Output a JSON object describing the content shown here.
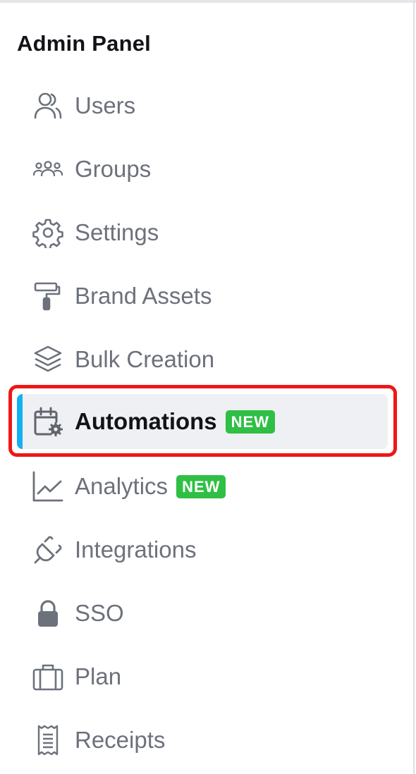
{
  "panel": {
    "title": "Admin Panel"
  },
  "nav": {
    "items": [
      {
        "label": "Users",
        "icon": "users-icon"
      },
      {
        "label": "Groups",
        "icon": "groups-icon"
      },
      {
        "label": "Settings",
        "icon": "gear-icon"
      },
      {
        "label": "Brand Assets",
        "icon": "paint-roller-icon"
      },
      {
        "label": "Bulk Creation",
        "icon": "layers-icon"
      },
      {
        "label": "Automations",
        "icon": "calendar-gear-icon",
        "active": true,
        "badge": "NEW"
      },
      {
        "label": "Analytics",
        "icon": "line-chart-icon",
        "badge": "NEW"
      },
      {
        "label": "Integrations",
        "icon": "plug-icon"
      },
      {
        "label": "SSO",
        "icon": "lock-icon"
      },
      {
        "label": "Plan",
        "icon": "briefcase-icon"
      },
      {
        "label": "Receipts",
        "icon": "receipt-icon"
      }
    ]
  },
  "colors": {
    "active_accent": "#14b0f2",
    "badge_green": "#2fbf45",
    "highlight_red": "#ee1717"
  }
}
